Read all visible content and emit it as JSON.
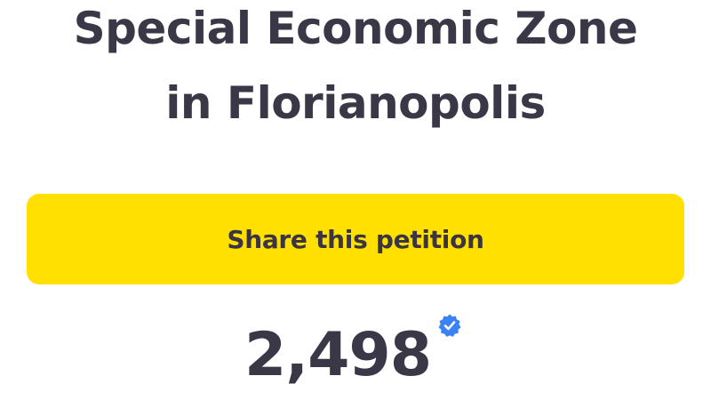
{
  "petition": {
    "title_line1": "Special Economic Zone",
    "title_line2": "in Florianopolis",
    "share_label": "Share this petition",
    "signature_count": "2,498",
    "verified_icon": "verified-badge-icon"
  },
  "colors": {
    "button_background": "#ffe000",
    "text": "#3a3847",
    "verified_badge": "#3b82f6"
  }
}
